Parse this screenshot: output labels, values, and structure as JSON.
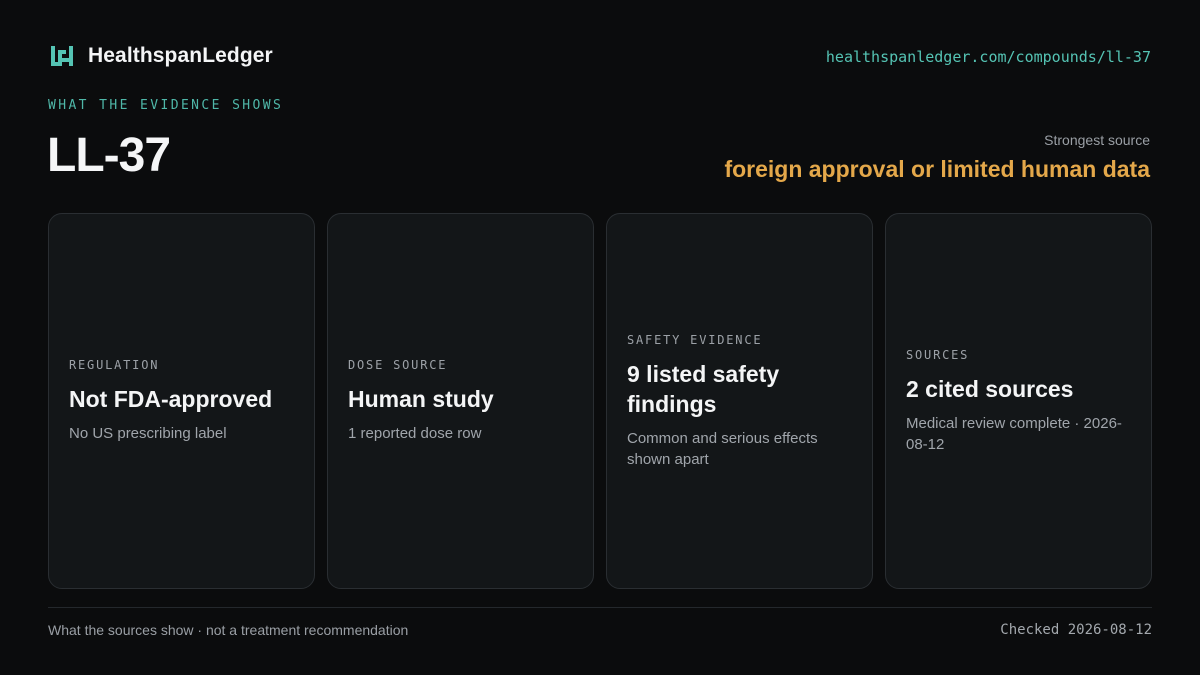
{
  "brand": {
    "name": "HealthspanLedger",
    "logo_icon": "ledger-mark-icon",
    "url": "healthspanledger.com/compounds/ll-37"
  },
  "header": {
    "eyebrow": "WHAT THE EVIDENCE SHOWS",
    "title": "LL-37",
    "strongest_label": "Strongest source",
    "strongest_value": "foreign approval or limited human data"
  },
  "cards": [
    {
      "label": "REGULATION",
      "value": "Not FDA-approved",
      "note": "No US prescribing label"
    },
    {
      "label": "DOSE SOURCE",
      "value": "Human study",
      "note": "1 reported dose row"
    },
    {
      "label": "SAFETY EVIDENCE",
      "value": "9 listed safety findings",
      "note": "Common and serious effects shown apart"
    },
    {
      "label": "SOURCES",
      "value": "2 cited sources",
      "note": "Medical review complete · 2026-08-12"
    }
  ],
  "footer": {
    "note": "What the sources show · not a treatment recommendation",
    "checked": "Checked 2026-08-12"
  },
  "colors": {
    "background": "#0b0c0d",
    "accent_teal": "#55c4b4",
    "accent_amber": "#e4a84a",
    "card_bg": "#131618"
  }
}
